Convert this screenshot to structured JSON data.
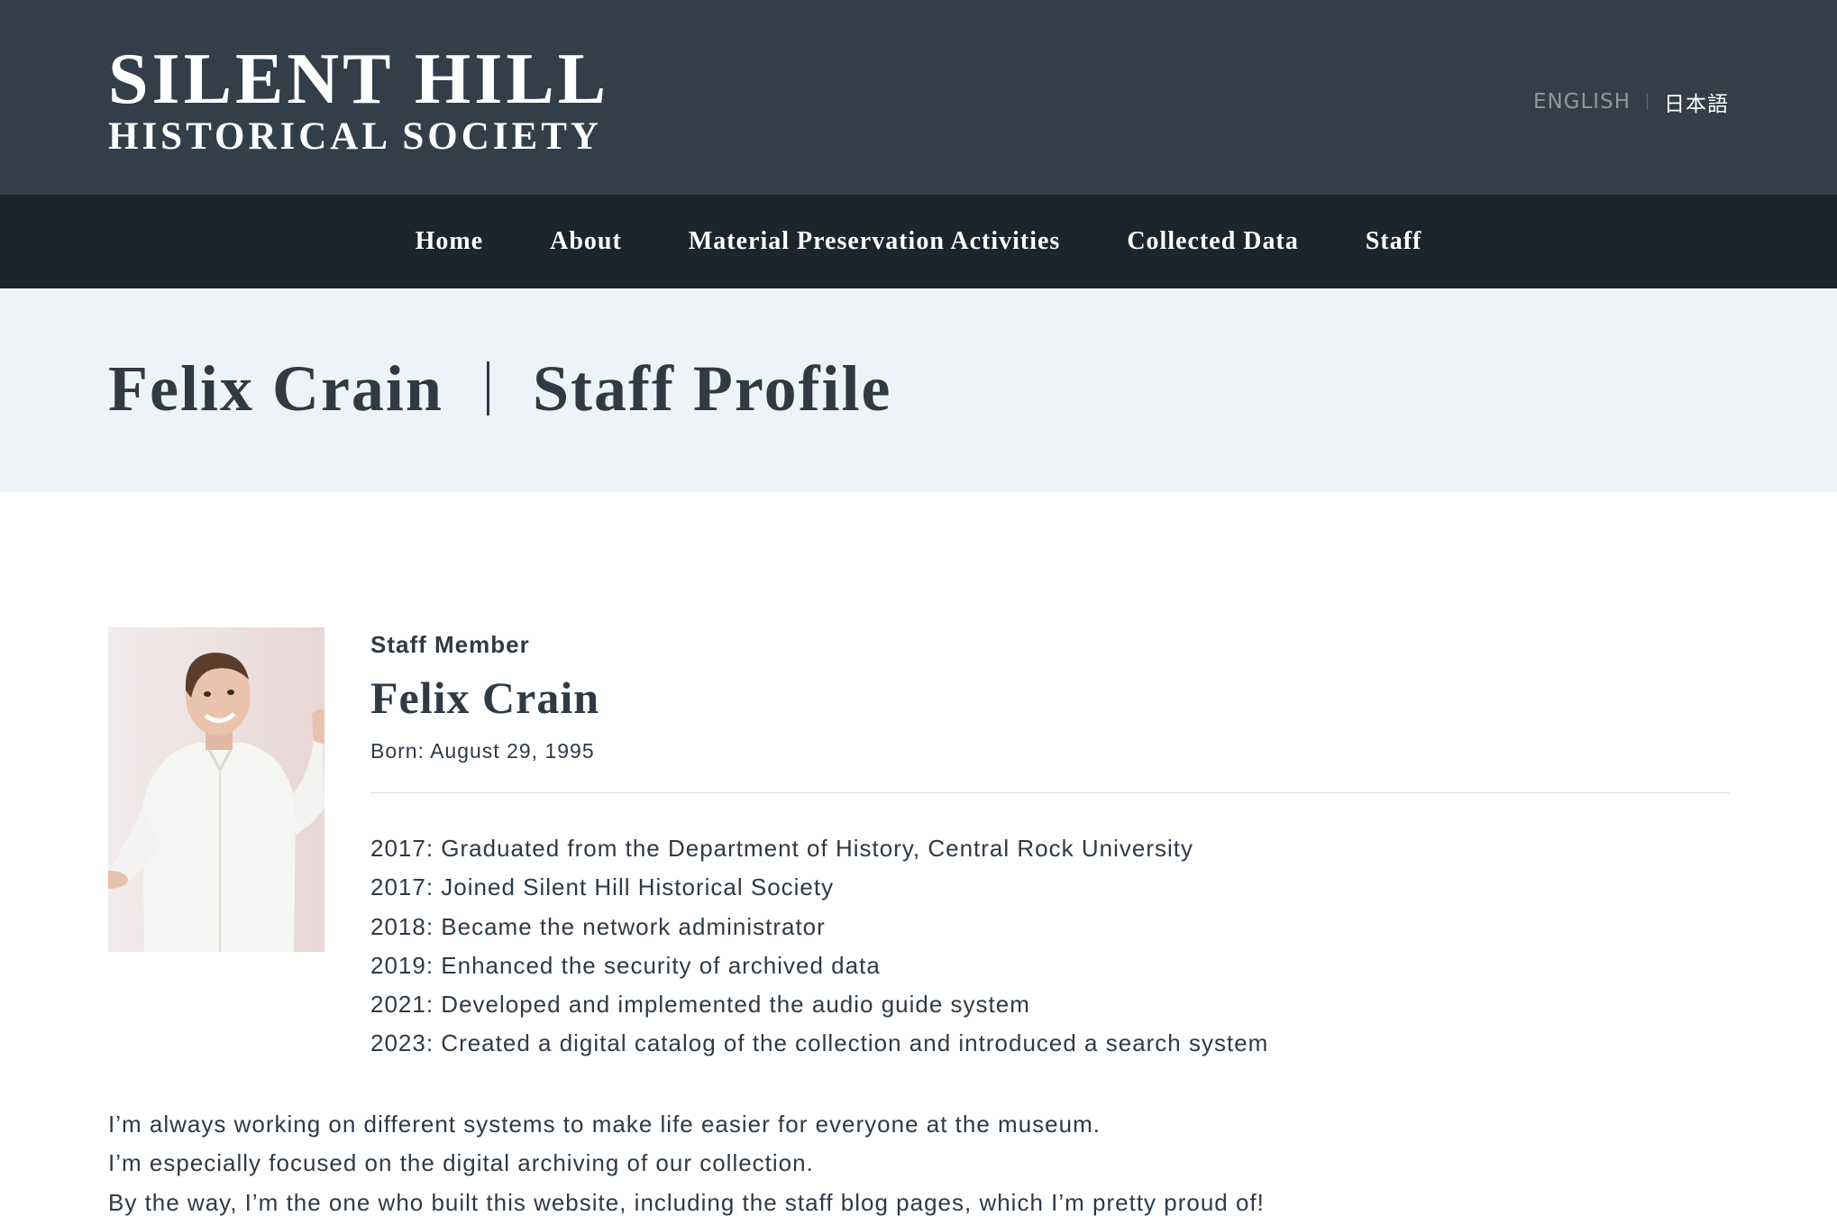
{
  "header": {
    "logo_line1": "SILENT HILL",
    "logo_line2": "HISTORICAL SOCIETY",
    "lang_english": "ENGLISH",
    "lang_japanese": "日本語"
  },
  "nav": {
    "items": [
      {
        "label": "Home"
      },
      {
        "label": "About"
      },
      {
        "label": "Material Preservation Activities"
      },
      {
        "label": "Collected Data"
      },
      {
        "label": "Staff"
      }
    ]
  },
  "title": {
    "name": "Felix Crain",
    "section": "Staff Profile"
  },
  "profile": {
    "role": "Staff Member",
    "name": "Felix Crain",
    "born": "Born: August 29, 1995",
    "timeline": [
      "2017: Graduated from the Department of History, Central Rock University",
      "2017: Joined Silent Hill Historical Society",
      "2018: Became the network administrator",
      "2019: Enhanced the security of archived data",
      "2021: Developed and implemented the audio guide system",
      "2023: Created a digital catalog of the collection and introduced a search system"
    ]
  },
  "bio": [
    "I’m always working on different systems to make life easier for everyone at the museum.",
    "I’m especially focused on the digital archiving of our collection.",
    "By the way, I’m the one who built this website, including the staff blog pages, which I’m pretty proud of!"
  ],
  "colors": {
    "header_bg": "#323e49",
    "nav_bg": "#1b252d",
    "title_band_bg": "#eef3f8",
    "text": "#2f3a44"
  }
}
